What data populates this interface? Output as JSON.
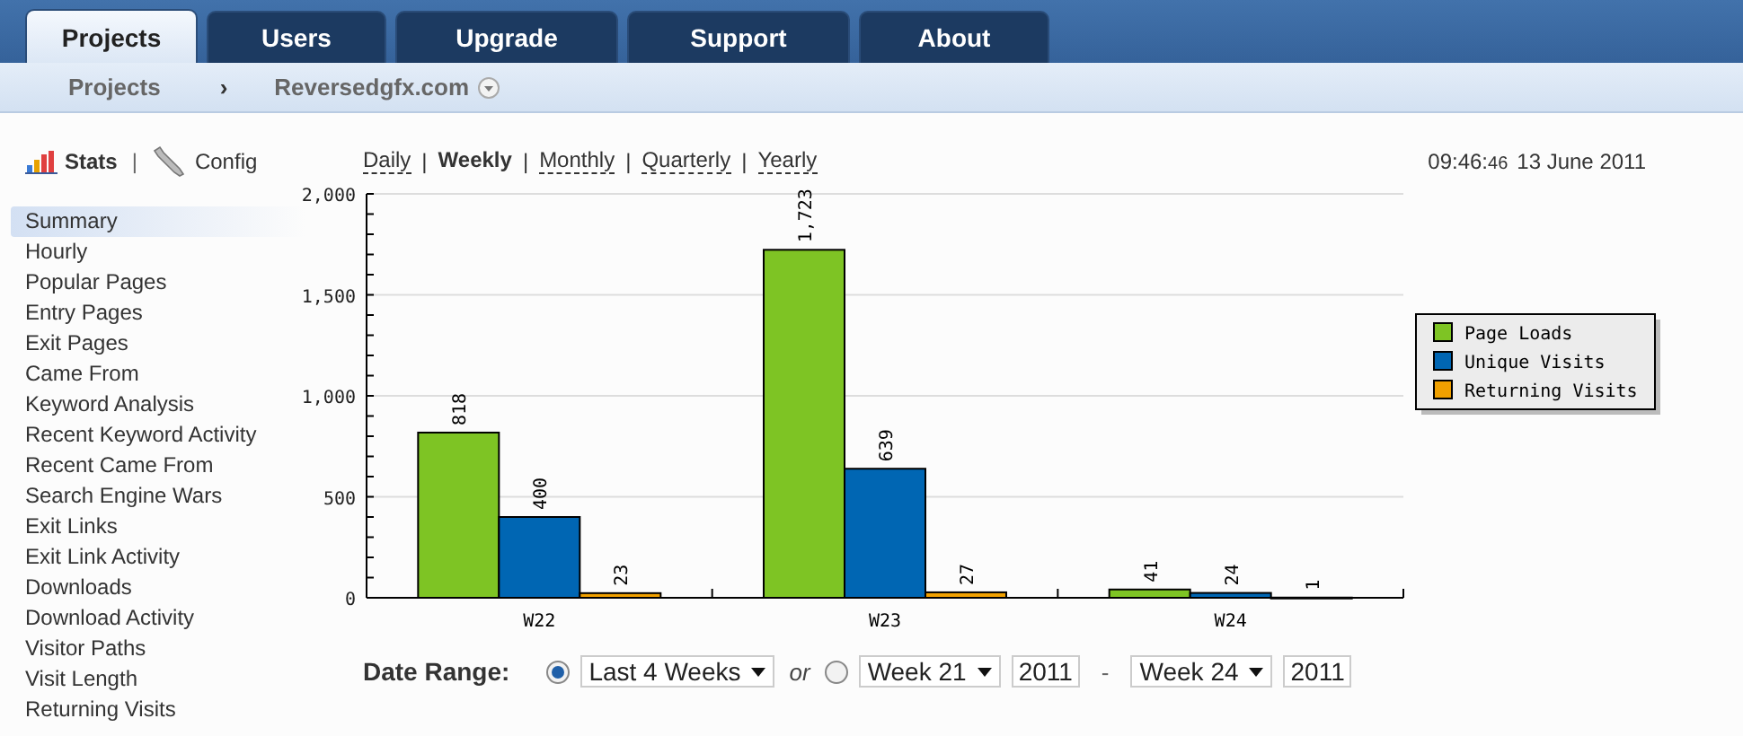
{
  "tabs": [
    {
      "label": "Projects",
      "selected": true
    },
    {
      "label": "Users",
      "selected": false
    },
    {
      "label": "Upgrade",
      "selected": false
    },
    {
      "label": "Support",
      "selected": false
    },
    {
      "label": "About",
      "selected": false
    }
  ],
  "breadcrumb": {
    "root": "Projects",
    "separator": "›",
    "current": "Reversedgfx.com"
  },
  "sidebar": {
    "separator": "|",
    "modes": [
      {
        "label": "Stats",
        "kind": "stats",
        "selected": true
      },
      {
        "label": "Config",
        "kind": "config",
        "selected": false
      }
    ],
    "items": [
      {
        "label": "Summary",
        "selected": true
      },
      {
        "label": "Hourly",
        "selected": false
      },
      {
        "label": "Popular Pages",
        "selected": false
      },
      {
        "label": "Entry Pages",
        "selected": false
      },
      {
        "label": "Exit Pages",
        "selected": false
      },
      {
        "label": "Came From",
        "selected": false
      },
      {
        "label": "Keyword Analysis",
        "selected": false
      },
      {
        "label": "Recent Keyword Activity",
        "selected": false
      },
      {
        "label": "Recent Came From",
        "selected": false
      },
      {
        "label": "Search Engine Wars",
        "selected": false
      },
      {
        "label": "Exit Links",
        "selected": false
      },
      {
        "label": "Exit Link Activity",
        "selected": false
      },
      {
        "label": "Downloads",
        "selected": false
      },
      {
        "label": "Download Activity",
        "selected": false
      },
      {
        "label": "Visitor Paths",
        "selected": false
      },
      {
        "label": "Visit Length",
        "selected": false
      },
      {
        "label": "Returning Visits",
        "selected": false
      }
    ]
  },
  "period_separator": "|",
  "periods": [
    {
      "label": "Daily",
      "selected": false
    },
    {
      "label": "Weekly",
      "selected": true
    },
    {
      "label": "Monthly",
      "selected": false
    },
    {
      "label": "Quarterly",
      "selected": false
    },
    {
      "label": "Yearly",
      "selected": false
    }
  ],
  "clock": {
    "time": "09:46:",
    "seconds": "46",
    "date": "13 June 2011"
  },
  "chart_data": {
    "type": "bar",
    "categories": [
      "W22",
      "W23",
      "W24"
    ],
    "series": [
      {
        "name": "Page Loads",
        "color": "#7ec424",
        "values": [
          818,
          1723,
          41
        ],
        "value_labels": [
          "818",
          "1,723",
          "41"
        ]
      },
      {
        "name": "Unique Visits",
        "color": "#0066b3",
        "values": [
          400,
          639,
          24
        ],
        "value_labels": [
          "400",
          "639",
          "24"
        ]
      },
      {
        "name": "Returning Visits",
        "color": "#f0a000",
        "values": [
          23,
          27,
          1
        ],
        "value_labels": [
          "23",
          "27",
          "1"
        ]
      }
    ],
    "grid": true,
    "legend": true,
    "ylim": [
      0,
      2000
    ],
    "yticks": [
      {
        "value": 0,
        "label": "0"
      },
      {
        "value": 500,
        "label": "500"
      },
      {
        "value": 1000,
        "label": "1,000"
      },
      {
        "value": 1500,
        "label": "1,500"
      },
      {
        "value": 2000,
        "label": "2,000"
      }
    ],
    "data_labels": true
  },
  "date_range": {
    "label": "Date Range:",
    "or": "or",
    "options": [
      {
        "kind": "preset",
        "selected": true,
        "value": "Last 4 Weeks"
      },
      {
        "kind": "custom",
        "selected": false,
        "from_week": "Week 21",
        "from_year": "2011",
        "separator": "-",
        "to_week": "Week 24",
        "to_year": "2011"
      }
    ]
  }
}
